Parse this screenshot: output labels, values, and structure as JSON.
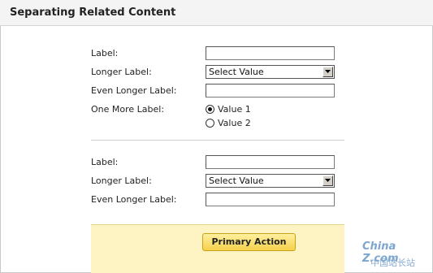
{
  "header": {
    "title": "Separating Related Content"
  },
  "section1": {
    "label1": "Label:",
    "label2": "Longer Label:",
    "select_value": "Select Value",
    "label3": "Even Longer Label:",
    "label4": "One More Label:",
    "radio1": "Value 1",
    "radio2": "Value 2"
  },
  "section2": {
    "label1": "Label:",
    "label2": "Longer Label:",
    "select_value": "Select Value",
    "label3": "Even Longer Label:"
  },
  "actions": {
    "primary_label": "Primary Action"
  },
  "watermark": {
    "brand": "China Z.com",
    "sub": "中国站长站"
  },
  "colors": {
    "action_bar": "#fdf3c3",
    "button_fill": "#f5d14a",
    "header_bg": "#f4f4f4"
  },
  "icons": {
    "select_arrow": "chevron-down-icon"
  }
}
